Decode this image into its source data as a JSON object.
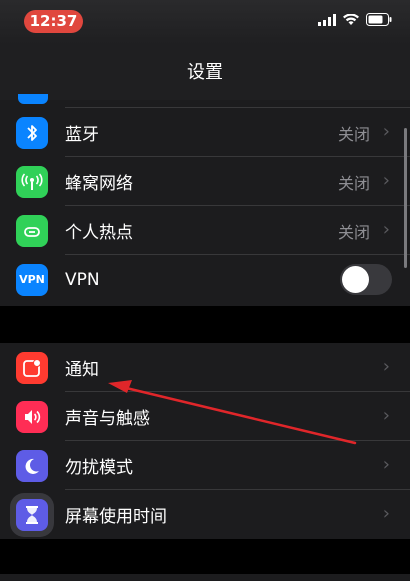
{
  "status_bar": {
    "time": "12:37",
    "time_pill_color": "#e0473e",
    "icons": [
      "signal-icon",
      "wifi-icon",
      "battery-icon"
    ]
  },
  "nav": {
    "title": "设置"
  },
  "network_section": {
    "items": [
      {
        "label": "蓝牙",
        "value": "关闭",
        "icon": "bluetooth-icon",
        "icon_color": "#0a84ff"
      },
      {
        "label": "蜂窝网络",
        "value": "关闭",
        "icon": "cellular-icon",
        "icon_color": "#30d158"
      },
      {
        "label": "个人热点",
        "value": "关闭",
        "icon": "hotspot-icon",
        "icon_color": "#30d158"
      },
      {
        "label": "VPN",
        "icon": "vpn-icon",
        "icon_text": "VPN",
        "icon_color": "#0a84ff",
        "toggle_on": false
      }
    ]
  },
  "notify_section": {
    "items": [
      {
        "label": "通知",
        "icon": "notifications-icon",
        "icon_color": "#ff3b30"
      },
      {
        "label": "声音与触感",
        "icon": "sounds-icon",
        "icon_color": "#ff2d55"
      },
      {
        "label": "勿扰模式",
        "icon": "do-not-disturb-icon",
        "icon_color": "#5e5ce6"
      },
      {
        "label": "屏幕使用时间",
        "icon": "screen-time-icon",
        "icon_color": "#5e5ce6"
      }
    ]
  },
  "annotation": {
    "arrow_color": "#e0262a"
  }
}
